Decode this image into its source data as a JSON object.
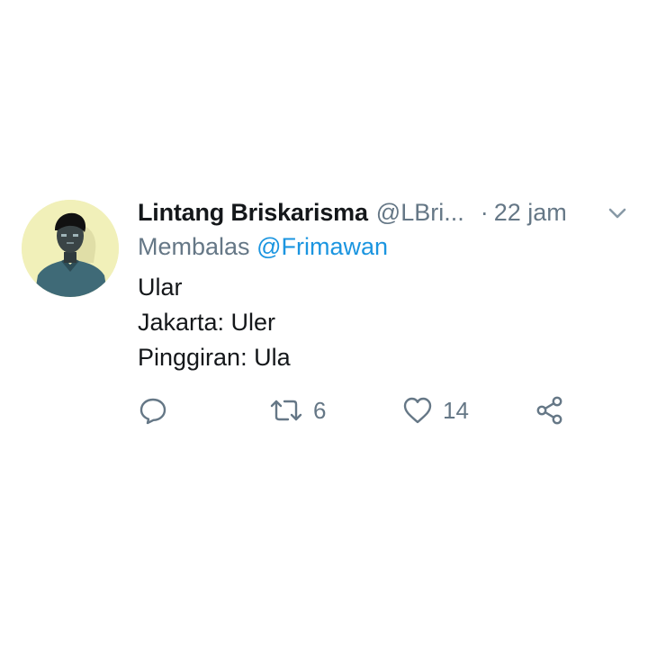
{
  "tweet": {
    "author_name": "Lintang Briskarisma",
    "handle": "@LBri...",
    "separator": "·",
    "time": "22 jam",
    "reply_prefix": "Membalas",
    "reply_mention": "@Frimawan",
    "lines": [
      "Ular",
      "Jakarta: Uler",
      "Pinggiran: Ula"
    ]
  },
  "actions": {
    "reply_icon": "reply-bubble-icon",
    "retweet_icon": "retweet-icon",
    "retweet_count": "6",
    "like_icon": "heart-icon",
    "like_count": "14",
    "share_icon": "share-icon"
  },
  "colors": {
    "text_primary": "#14171a",
    "text_secondary": "#657786",
    "link": "#1b95e0",
    "avatar_background": "#f1f0b9"
  }
}
